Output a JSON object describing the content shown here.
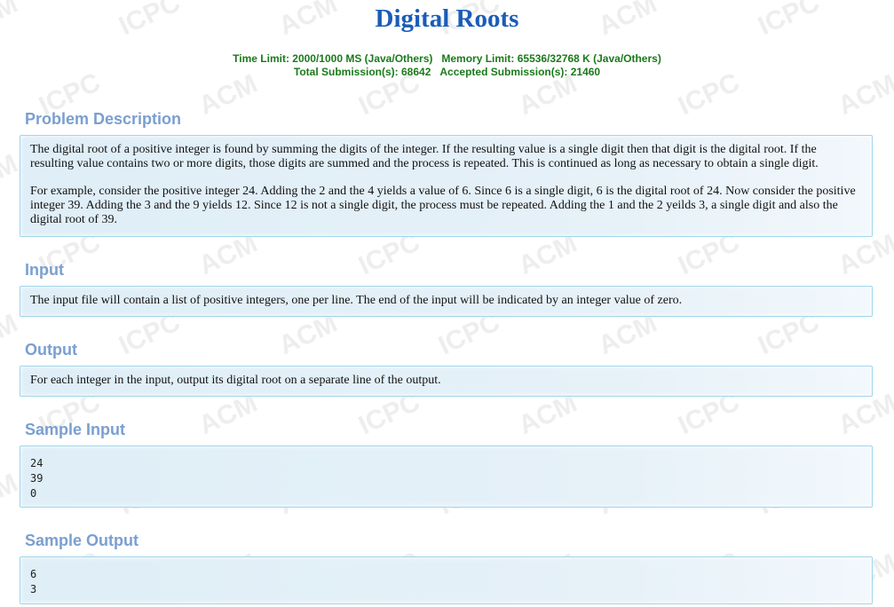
{
  "problem": {
    "title": "Digital Roots",
    "limits": {
      "time": "Time Limit: 2000/1000 MS (Java/Others)",
      "memory": "Memory Limit: 65536/32768 K (Java/Others)",
      "total": "Total Submission(s): 68642",
      "accepted": "Accepted Submission(s): 21460"
    }
  },
  "sections": {
    "description": {
      "title": "Problem Description",
      "p1": "The digital root of a positive integer is found by summing the digits of the integer. If the resulting value is a single digit then that digit is the digital root. If the resulting value contains two or more digits, those digits are summed and the process is repeated. This is continued as long as necessary to obtain a single digit.",
      "p2": "For example, consider the positive integer 24. Adding the 2 and the 4 yields a value of 6. Since 6 is a single digit, 6 is the digital root of 24. Now consider the positive integer 39. Adding the 3 and the 9 yields 12. Since 12 is not a single digit, the process must be repeated. Adding the 1 and the 2 yeilds 3, a single digit and also the digital root of 39."
    },
    "input": {
      "title": "Input",
      "text": "The input file will contain a list of positive integers, one per line. The end of the input will be indicated by an integer value of zero."
    },
    "output": {
      "title": "Output",
      "text": "For each integer in the input, output its digital root on a separate line of the output."
    },
    "sample_input": {
      "title": "Sample Input",
      "text": "24\n39\n0"
    },
    "sample_output": {
      "title": "Sample Output",
      "text": "6\n3"
    }
  },
  "watermark": {
    "words": [
      "ACM",
      "ICPC"
    ],
    "color": "#eeeeee"
  }
}
